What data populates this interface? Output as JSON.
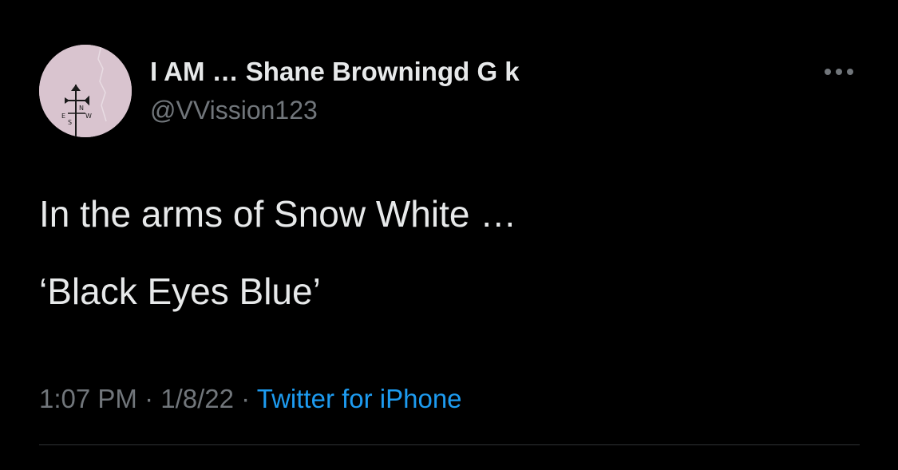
{
  "user": {
    "display_name": "I AM … Shane Browningd G k",
    "handle": "@VVission123",
    "avatar_icon": "weathervane-avatar"
  },
  "tweet": {
    "line1": "In the arms of Snow White …",
    "line2": "‘Black Eyes Blue’"
  },
  "meta": {
    "time": "1:07 PM",
    "separator": "·",
    "date": "1/8/22",
    "source": "Twitter for iPhone"
  },
  "more_icon": "more-horizontal-icon",
  "colors": {
    "background": "#000000",
    "primary_text": "#e7e9ea",
    "secondary_text": "#71767b",
    "link": "#1d9bf0",
    "divider": "#2f3336"
  }
}
